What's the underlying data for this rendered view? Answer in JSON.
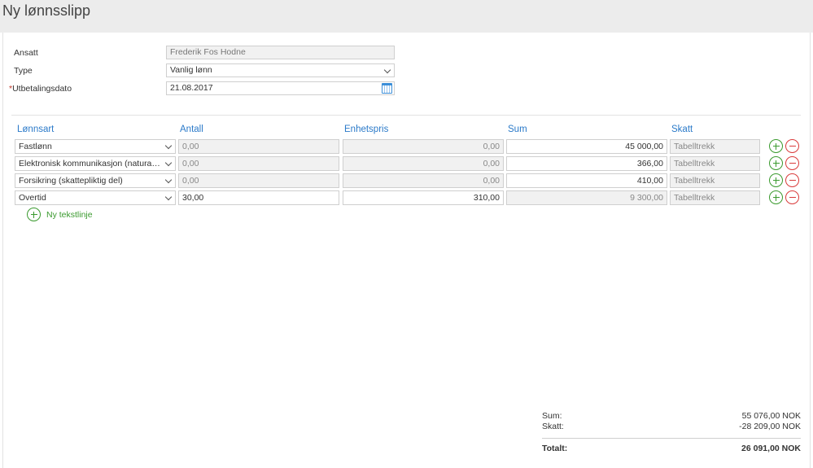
{
  "page": {
    "title": "Ny lønnsslipp"
  },
  "form": {
    "employee": {
      "label": "Ansatt",
      "value": "Frederik Fos Hodne"
    },
    "type": {
      "label": "Type",
      "value": "Vanlig lønn"
    },
    "date": {
      "required_mark": "*",
      "label": "Utbetalingsdato",
      "value": "21.08.2017"
    }
  },
  "table": {
    "headers": [
      "Lønnsart",
      "Antall",
      "Enhetspris",
      "Sum",
      "Skatt"
    ],
    "rows": [
      {
        "type": "Fastlønn",
        "qty": "0,00",
        "unit_price": "0,00",
        "sum": "45 000,00",
        "tax": "Tabelltrekk"
      },
      {
        "type": "Elektronisk kommunikasjon (naturalytelse)",
        "qty": "0,00",
        "unit_price": "0,00",
        "sum": "366,00",
        "tax": "Tabelltrekk"
      },
      {
        "type": "Forsikring (skattepliktig del)",
        "qty": "0,00",
        "unit_price": "0,00",
        "sum": "410,00",
        "tax": "Tabelltrekk"
      },
      {
        "type": "Overtid",
        "qty": "30,00",
        "unit_price": "310,00",
        "sum": "9 300,00",
        "tax": "Tabelltrekk"
      }
    ]
  },
  "new_line": {
    "label": "Ny tekstlinje"
  },
  "totals": {
    "sum_label": "Sum:",
    "sum_value": "55 076,00 NOK",
    "tax_label": "Skatt:",
    "tax_value": "-28 209,00 NOK",
    "total_label": "Totalt:",
    "total_value": "26 091,00 NOK"
  },
  "colors": {
    "accent": "#2b7ac9",
    "add": "#3a9a2e",
    "remove": "#d93b3b"
  }
}
